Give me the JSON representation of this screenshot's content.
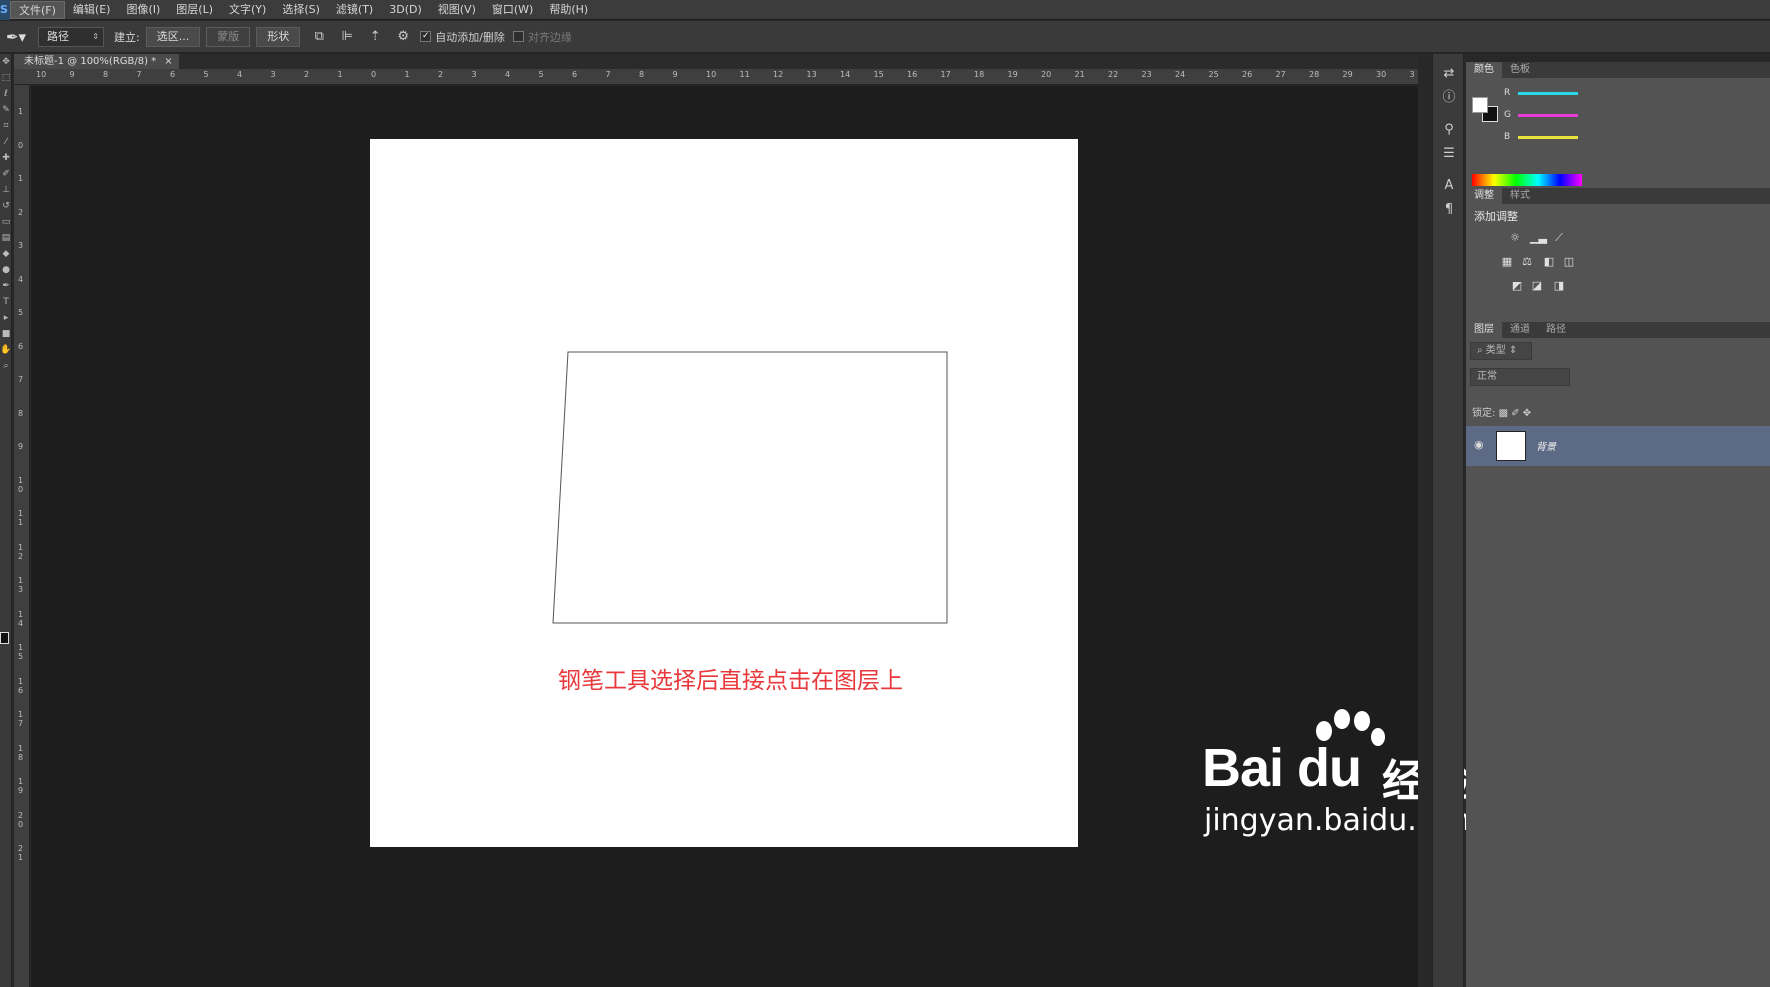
{
  "app_logo": "S",
  "menu": [
    "文件(F)",
    "编辑(E)",
    "图像(I)",
    "图层(L)",
    "文字(Y)",
    "选择(S)",
    "滤镜(T)",
    "3D(D)",
    "视图(V)",
    "窗口(W)",
    "帮助(H)"
  ],
  "options": {
    "mode_select": "路径",
    "make_label": "建立:",
    "selection_btn": "选区...",
    "mask_btn": "蒙版",
    "shape_btn": "形状",
    "auto_add_delete": "自动添加/删除",
    "align_edges": "对齐边缘"
  },
  "document": {
    "tab_title": "未标题-1 @ 100%(RGB/8) *",
    "close": "×"
  },
  "ruler": {
    "top_labels": [
      "10",
      "9",
      "8",
      "7",
      "6",
      "5",
      "4",
      "3",
      "2",
      "1",
      "0",
      "1",
      "2",
      "3",
      "4",
      "5",
      "6",
      "7",
      "8",
      "9",
      "10",
      "11",
      "12",
      "13",
      "14",
      "15",
      "16",
      "17",
      "18",
      "19",
      "20",
      "21",
      "22",
      "23",
      "24",
      "25",
      "26",
      "27",
      "28",
      "29",
      "30",
      "3"
    ],
    "left_labels": [
      "1",
      "0",
      "1",
      "2",
      "3",
      "4",
      "5",
      "6",
      "7",
      "8",
      "9",
      "1 0",
      "1 1",
      "1 2",
      "1 3",
      "1 4",
      "1 5",
      "1 6",
      "1 7",
      "1 8",
      "1 9",
      "2 0",
      "2 1"
    ]
  },
  "canvas": {
    "caption": "钢笔工具选择后直接点击在图层上",
    "caption_color": "#e8383b"
  },
  "watermark": {
    "brand": "Bai du",
    "product": "经验",
    "url": "jingyan.baidu.com"
  },
  "panels": {
    "color_tabs": [
      "颜色",
      "色板"
    ],
    "channels": [
      "R",
      "G",
      "B"
    ],
    "adjust_tabs": [
      "调整",
      "样式"
    ],
    "adjust_title": "添加调整",
    "layer_tabs": [
      "图层",
      "通道",
      "路径"
    ],
    "layer_filter": "类型",
    "blend_mode": "正常",
    "lock_label": "锁定:",
    "layer_name": "背景"
  }
}
